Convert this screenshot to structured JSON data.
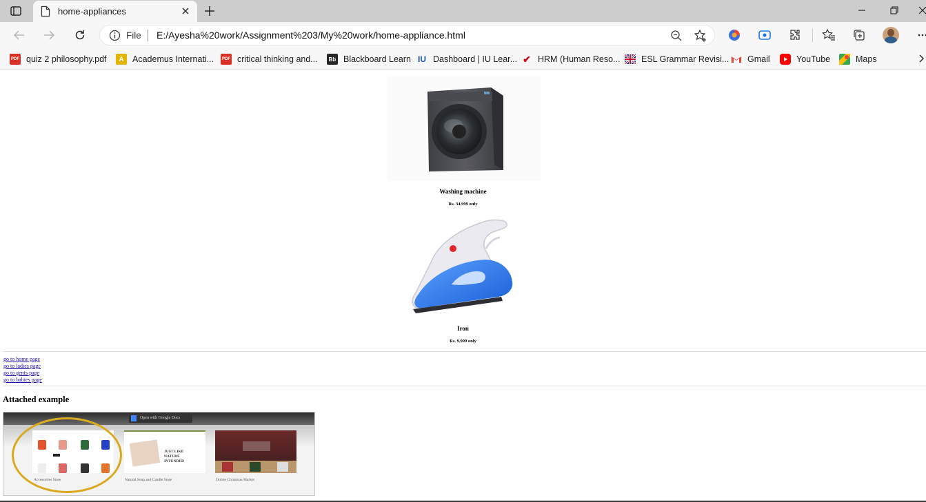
{
  "browser": {
    "tab_title": "home-appliances",
    "file_label": "File",
    "url": "E:/Ayesha%20work/Assignment%203/My%20work/home-appliance.html"
  },
  "bookmarks": [
    {
      "label": "quiz 2 philosophy.pdf",
      "icon": "pdf-icon",
      "color": "#d93025"
    },
    {
      "label": "Academus Internati...",
      "icon": "academus-icon",
      "color": "#8a6d00"
    },
    {
      "label": "critical thinking and...",
      "icon": "pdf-icon",
      "color": "#d93025"
    },
    {
      "label": "Blackboard Learn",
      "icon": "blackboard-icon",
      "color": "#262626"
    },
    {
      "label": "Dashboard | IU Lear...",
      "icon": "iu-icon",
      "color": "#1a56b0"
    },
    {
      "label": "HRM (Human Reso...",
      "icon": "hrm-icon",
      "color": "#d0021b"
    },
    {
      "label": "ESL Grammar Revisi...",
      "icon": "uk-flag-icon",
      "color": "#1f3a93"
    },
    {
      "label": "Gmail",
      "icon": "gmail-icon",
      "color": "#ea4335"
    },
    {
      "label": "YouTube",
      "icon": "youtube-icon",
      "color": "#ff0000"
    },
    {
      "label": "Maps",
      "icon": "maps-icon",
      "color": "#34a853"
    }
  ],
  "products": [
    {
      "name": "Washing machine",
      "price": "Rs. 34,999 only"
    },
    {
      "name": "Iron",
      "price": "Rs. 9,999 only"
    }
  ],
  "links": [
    "go to home page",
    "go to ladies page",
    "go to gents page",
    "go to babies page"
  ],
  "attached": {
    "heading": "Attached example",
    "topbar_text": "Open with Google Docs",
    "cards": [
      "Accessories Store",
      "Natural Soap and Candle Store",
      "Online Christmas Market"
    ],
    "card_banner": "JUST LIKE NATURE INTENDED"
  }
}
